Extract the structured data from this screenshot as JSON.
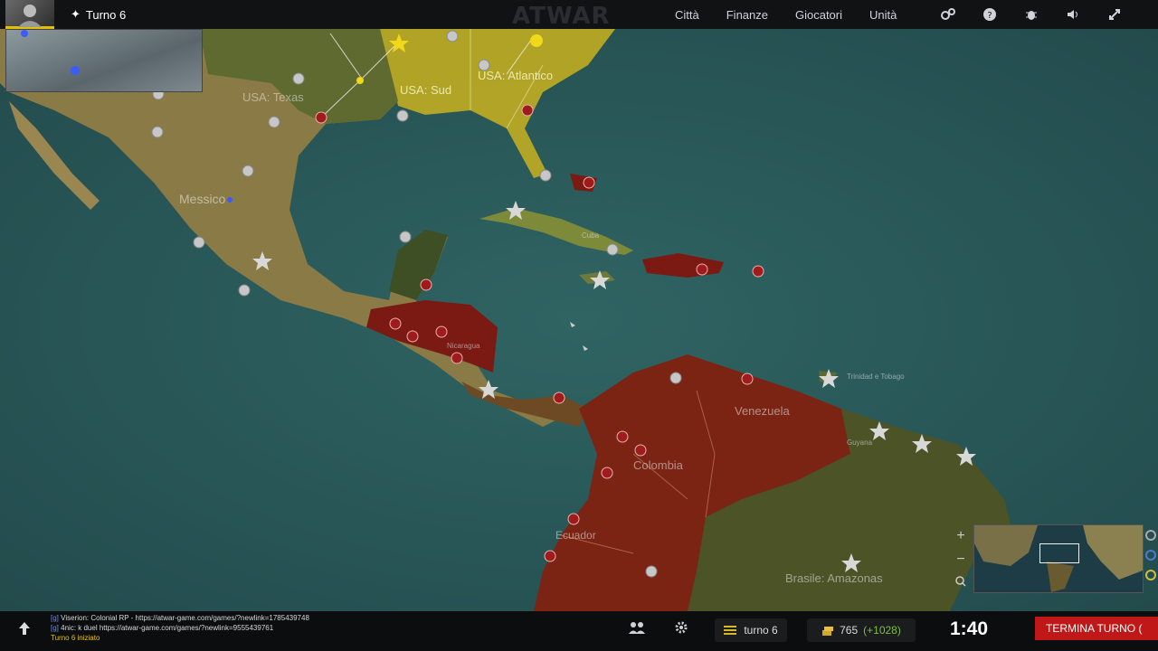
{
  "header": {
    "turn_label": "Turno 6",
    "logo_text": "ATWAR",
    "nav": [
      "Città",
      "Finanze",
      "Giocatori",
      "Unità"
    ],
    "icons": [
      "gears-icon",
      "help-icon",
      "bug-icon",
      "sound-icon",
      "fullscreen-icon"
    ]
  },
  "map": {
    "regions": [
      {
        "name": "USA: Texas"
      },
      {
        "name": "USA: Sud"
      },
      {
        "name": "USA: Atlantico"
      },
      {
        "name": "Messico"
      },
      {
        "name": "Venezuela"
      },
      {
        "name": "Colombia"
      },
      {
        "name": "Ecuador"
      },
      {
        "name": "Brasile: Amazonas"
      },
      {
        "name": "Trinidad e Tobago"
      },
      {
        "name": "Guyana"
      },
      {
        "name": "Nicaragua"
      },
      {
        "name": "Cuba"
      }
    ]
  },
  "chat": {
    "lines": [
      {
        "tag": "[g]",
        "text": "Viserion: Colonial RP - https://atwar-game.com/games/?newlink=1785439748"
      },
      {
        "tag": "[g]",
        "text": "4nic: k duel https://atwar-game.com/games/?newlink=9555439761"
      }
    ],
    "system": "Turno 6 iniziato"
  },
  "footer": {
    "turn_text": "turno 6",
    "gold": "765",
    "gold_delta": "(+1028)",
    "timer": "1:40",
    "end_turn": "TERMINA TURNO ("
  },
  "colors": {
    "player_yellow": "#d9c21a",
    "enemy_red": "#8a1e14",
    "end_turn_red": "#c01818",
    "ocean": "#2b5a5a"
  }
}
